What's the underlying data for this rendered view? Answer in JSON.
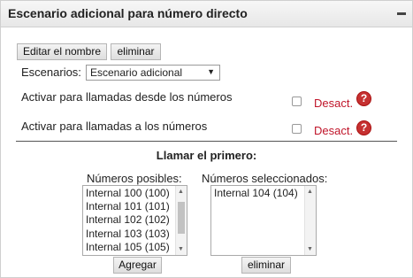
{
  "header": {
    "title": "Escenario adicional para número directo"
  },
  "toolbar": {
    "rename_label": "Editar el nombre",
    "delete_label": "eliminar"
  },
  "scenarios": {
    "label": "Escenarios:",
    "selected": "Escenario adicional"
  },
  "options": [
    {
      "label": "Activar para llamadas desde los números",
      "state": "Desact."
    },
    {
      "label": "Activar para llamadas a los números",
      "state": "Desact."
    }
  ],
  "help_glyph": "?",
  "call_first": {
    "title": "Llamar el primero:",
    "available_label": "Números posibles:",
    "available": [
      "Internal 100 (100)",
      "Internal 101 (101)",
      "Internal 102 (102)",
      "Internal 103 (103)",
      "Internal 105 (105)"
    ],
    "selected_label": "Números seleccionados:",
    "selected": [
      "Internal 104 (104)"
    ],
    "add_label": "Agregar",
    "remove_label": "eliminar"
  }
}
